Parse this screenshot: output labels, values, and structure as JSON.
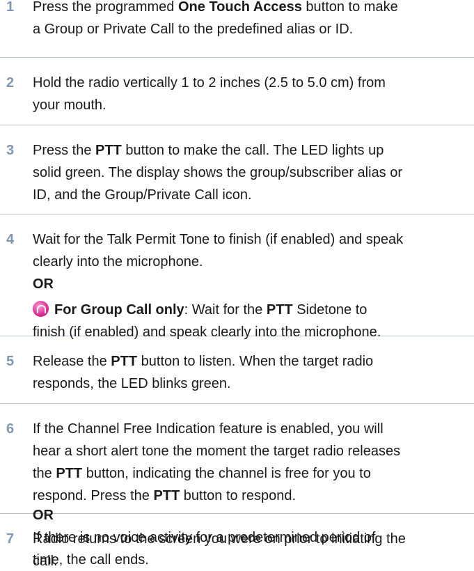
{
  "steps": [
    {
      "num": "1",
      "lines": [
        [
          {
            "t": "Press the programmed "
          },
          {
            "t": "One Touch Access",
            "b": true
          },
          {
            "t": " button to make"
          }
        ],
        [
          {
            "t": "a Group or Private Call to the predefined alias or ID."
          }
        ]
      ]
    },
    {
      "num": "2",
      "lines": [
        [
          {
            "t": "Hold the radio vertically 1 to 2 inches (2.5 to 5.0 cm) from"
          }
        ],
        [
          {
            "t": "your mouth."
          }
        ]
      ]
    },
    {
      "num": "3",
      "lines": [
        [
          {
            "t": "Press the "
          },
          {
            "t": "PTT",
            "b": true
          },
          {
            "t": " button to make the call. The LED lights up"
          }
        ],
        [
          {
            "t": "solid green. The display shows the group/subscriber alias or"
          }
        ],
        [
          {
            "t": "ID, and the Group/Private Call icon."
          }
        ]
      ]
    },
    {
      "num": "4",
      "lines": [
        [
          {
            "t": "Wait for the Talk Permit Tone to finish (if enabled) and speak"
          }
        ],
        [
          {
            "t": "clearly into the microphone."
          }
        ],
        [
          {
            "t": "OR",
            "b": true
          }
        ],
        [
          {
            "icon": "pink-feature-icon"
          },
          {
            "t": "For Group Call only",
            "b": true
          },
          {
            "t": ": Wait for the "
          },
          {
            "t": "PTT",
            "b": true
          },
          {
            "t": " Sidetone to"
          }
        ],
        [
          {
            "t": "finish (if enabled) and speak clearly into the microphone."
          }
        ]
      ]
    },
    {
      "num": "5",
      "lines": [
        [
          {
            "t": "Release the "
          },
          {
            "t": "PTT",
            "b": true
          },
          {
            "t": " button to listen. When the target radio"
          }
        ],
        [
          {
            "t": "responds, the LED blinks green."
          }
        ]
      ]
    },
    {
      "num": "6",
      "lines": [
        [
          {
            "t": "If the Channel Free Indication feature is enabled, you will"
          }
        ],
        [
          {
            "t": "hear a short alert tone the moment the target radio releases"
          }
        ],
        [
          {
            "t": "the "
          },
          {
            "t": "PTT",
            "b": true
          },
          {
            "t": " button, indicating the channel is free for you to"
          }
        ],
        [
          {
            "t": "respond. Press the "
          },
          {
            "t": "PTT",
            "b": true
          },
          {
            "t": " button to respond."
          }
        ],
        [
          {
            "t": "OR",
            "b": true
          }
        ],
        [
          {
            "t": "If there is no voice activity for a predetermined period of"
          }
        ],
        [
          {
            "t": "time, the call ends."
          }
        ]
      ]
    },
    {
      "num": "7",
      "lines": [
        [
          {
            "t": "Radio returns to the screen you were on prior to initiating the"
          }
        ],
        [
          {
            "t": "call."
          }
        ]
      ]
    }
  ]
}
